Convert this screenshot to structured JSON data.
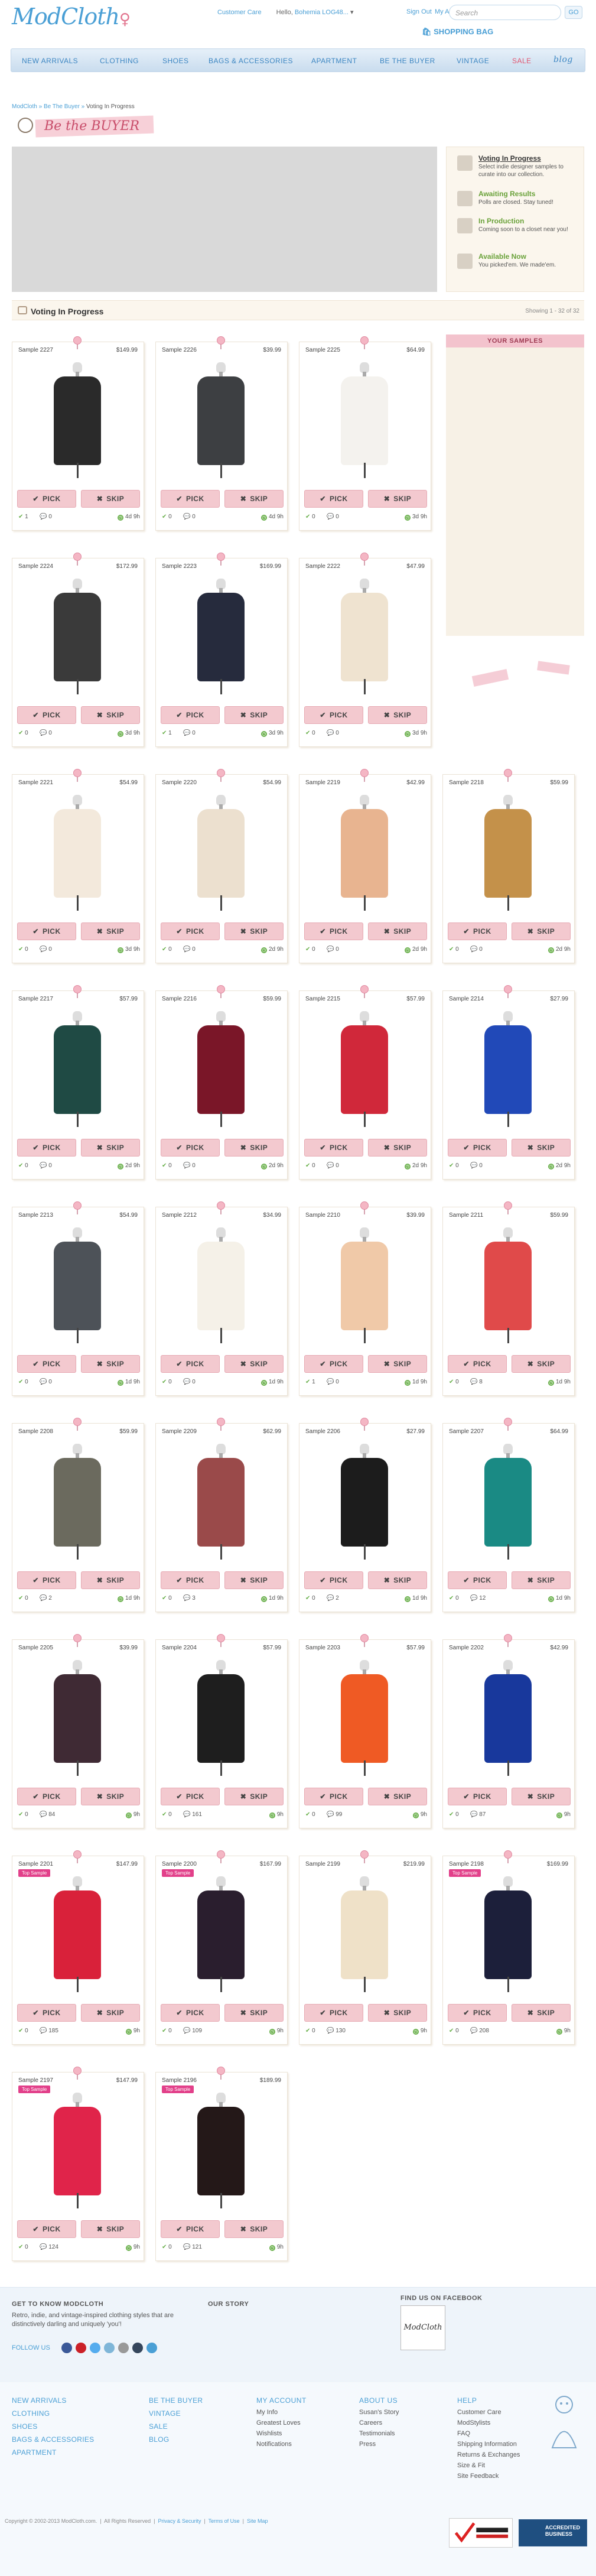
{
  "header": {
    "logo": "ModCloth",
    "customer_care": "Customer Care",
    "hello_prefix": "Hello,",
    "hello_name": "Bohemia LOG48...",
    "sign_out": "Sign Out",
    "my_account": "My Account",
    "search_placeholder": "Search",
    "search_go": "GO",
    "bag": "SHOPPING BAG"
  },
  "nav": [
    "NEW ARRIVALS",
    "CLOTHING",
    "SHOES",
    "BAGS & ACCESSORIES",
    "APARTMENT",
    "BE THE BUYER",
    "VINTAGE",
    "SALE",
    "blog"
  ],
  "breadcrumb": [
    "ModCloth",
    "Be The Buyer",
    "Voting In Progress"
  ],
  "banner_title": "Be the BUYER",
  "steps": [
    {
      "title": "Voting In Progress",
      "desc": "Select indie designer samples to curate into our collection."
    },
    {
      "title": "Awaiting Results",
      "desc": "Polls are closed. Stay tuned!"
    },
    {
      "title": "In Production",
      "desc": "Coming soon to a closet near you!"
    },
    {
      "title": "Available Now",
      "desc": "You picked'em. We made'em."
    }
  ],
  "section": {
    "title": "Voting In Progress",
    "count": "Showing 1 - 32 of 32"
  },
  "your_samples": "YOUR SAMPLES",
  "pick_label": "PICK",
  "skip_label": "SKIP",
  "products": [
    {
      "name": "Sample 2227",
      "price": "$149.99",
      "picks": "1",
      "comments": "0",
      "time": "4d 9h",
      "color": "#2a2a2a"
    },
    {
      "name": "Sample 2226",
      "price": "$39.99",
      "picks": "0",
      "comments": "0",
      "time": "4d 9h",
      "color": "#3d3f42"
    },
    {
      "name": "Sample 2225",
      "price": "$64.99",
      "picks": "0",
      "comments": "0",
      "time": "3d 9h",
      "color": "#f4f2ee"
    },
    {
      "name": "Sample 2224",
      "price": "$172.99",
      "picks": "0",
      "comments": "0",
      "time": "3d 9h",
      "color": "#3a3a3a"
    },
    {
      "name": "Sample 2223",
      "price": "$169.99",
      "picks": "1",
      "comments": "0",
      "time": "3d 9h",
      "color": "#262b3d"
    },
    {
      "name": "Sample 2222",
      "price": "$47.99",
      "picks": "0",
      "comments": "0",
      "time": "3d 9h",
      "color": "#efe3d0"
    },
    {
      "name": "Sample 2221",
      "price": "$54.99",
      "picks": "0",
      "comments": "0",
      "time": "3d 9h",
      "color": "#f3e9dc"
    },
    {
      "name": "Sample 2220",
      "price": "$54.99",
      "picks": "0",
      "comments": "0",
      "time": "2d 9h",
      "color": "#ece0cf"
    },
    {
      "name": "Sample 2219",
      "price": "$42.99",
      "picks": "0",
      "comments": "0",
      "time": "2d 9h",
      "color": "#e8b490"
    },
    {
      "name": "Sample 2218",
      "price": "$59.99",
      "picks": "0",
      "comments": "0",
      "time": "2d 9h",
      "color": "#c4914a"
    },
    {
      "name": "Sample 2217",
      "price": "$57.99",
      "picks": "0",
      "comments": "0",
      "time": "2d 9h",
      "color": "#1f4a44"
    },
    {
      "name": "Sample 2216",
      "price": "$59.99",
      "picks": "0",
      "comments": "0",
      "time": "2d 9h",
      "color": "#7a1628"
    },
    {
      "name": "Sample 2215",
      "price": "$57.99",
      "picks": "0",
      "comments": "0",
      "time": "2d 9h",
      "color": "#d0283a"
    },
    {
      "name": "Sample 2214",
      "price": "$27.99",
      "picks": "0",
      "comments": "0",
      "time": "2d 9h",
      "color": "#2149b8"
    },
    {
      "name": "Sample 2213",
      "price": "$54.99",
      "picks": "0",
      "comments": "0",
      "time": "1d 9h",
      "color": "#4d5258"
    },
    {
      "name": "Sample 2212",
      "price": "$34.99",
      "picks": "0",
      "comments": "0",
      "time": "1d 9h",
      "color": "#f5f1e8"
    },
    {
      "name": "Sample 2210",
      "price": "$39.99",
      "picks": "1",
      "comments": "0",
      "time": "1d 9h",
      "color": "#f0c9a8"
    },
    {
      "name": "Sample 2211",
      "price": "$59.99",
      "picks": "0",
      "comments": "8",
      "time": "1d 9h",
      "color": "#e04a4a"
    },
    {
      "name": "Sample 2208",
      "price": "$59.99",
      "picks": "0",
      "comments": "2",
      "time": "1d 9h",
      "color": "#6b6a5e"
    },
    {
      "name": "Sample 2209",
      "price": "$62.99",
      "picks": "0",
      "comments": "3",
      "time": "1d 9h",
      "color": "#9a4a4a"
    },
    {
      "name": "Sample 2206",
      "price": "$27.99",
      "picks": "0",
      "comments": "2",
      "time": "1d 9h",
      "color": "#1c1c1c"
    },
    {
      "name": "Sample 2207",
      "price": "$64.99",
      "picks": "0",
      "comments": "12",
      "time": "1d 9h",
      "color": "#1a8a84"
    },
    {
      "name": "Sample 2205",
      "price": "$39.99",
      "picks": "0",
      "comments": "84",
      "time": "9h",
      "color": "#3f2a34"
    },
    {
      "name": "Sample 2204",
      "price": "$57.99",
      "picks": "0",
      "comments": "161",
      "time": "9h",
      "color": "#1e1e1e"
    },
    {
      "name": "Sample 2203",
      "price": "$57.99",
      "picks": "0",
      "comments": "99",
      "time": "9h",
      "color": "#ef5a24"
    },
    {
      "name": "Sample 2202",
      "price": "$42.99",
      "picks": "0",
      "comments": "87",
      "time": "9h",
      "color": "#18389c"
    },
    {
      "name": "Sample 2201",
      "price": "$147.99",
      "picks": "0",
      "comments": "185",
      "time": "9h",
      "color": "#d9213a",
      "badge": "Top Sample"
    },
    {
      "name": "Sample 2200",
      "price": "$167.99",
      "picks": "0",
      "comments": "109",
      "time": "9h",
      "color": "#2a1e2e",
      "badge": "Top Sample"
    },
    {
      "name": "Sample 2199",
      "price": "$219.99",
      "picks": "0",
      "comments": "130",
      "time": "9h",
      "color": "#efe1c8"
    },
    {
      "name": "Sample 2198",
      "price": "$169.99",
      "picks": "0",
      "comments": "208",
      "time": "9h",
      "color": "#1c1f3a",
      "badge": "Top Sample"
    },
    {
      "name": "Sample 2197",
      "price": "$147.99",
      "picks": "0",
      "comments": "124",
      "time": "9h",
      "color": "#e0244a",
      "badge": "Top Sample"
    },
    {
      "name": "Sample 2196",
      "price": "$189.99",
      "picks": "0",
      "comments": "121",
      "time": "9h",
      "color": "#241818",
      "badge": "Top Sample"
    }
  ],
  "footer": {
    "about_title": "GET TO KNOW MODCLOTH",
    "about_text": "Retro, indie, and vintage-inspired clothing styles that are distinctively darling and uniquely 'you'!",
    "story_title": "OUR STORY",
    "fb_title": "FIND US ON FACEBOOK",
    "fb_logo": "ModCloth",
    "follow_us": "FOLLOW US",
    "col1": [
      "NEW ARRIVALS",
      "CLOTHING",
      "SHOES",
      "BAGS & ACCESSORIES",
      "APARTMENT"
    ],
    "col2": [
      "BE THE BUYER",
      "VINTAGE",
      "SALE",
      "BLOG"
    ],
    "col3_title": "MY ACCOUNT",
    "col3": [
      "My Info",
      "Greatest Loves",
      "Wishlists",
      "Notifications"
    ],
    "col4_title": "ABOUT US",
    "col4": [
      "Susan's Story",
      "Careers",
      "Testimonials",
      "Press"
    ],
    "col5_title": "HELP",
    "col5": [
      "Customer Care",
      "ModStylists",
      "FAQ",
      "Shipping Information",
      "Returns & Exchanges",
      "Size & Fit",
      "Site Feedback"
    ],
    "copyright": "Copyright © 2002-2013 ModCloth.com.",
    "rights": "All Rights Reserved",
    "privacy": "Privacy & Security",
    "terms": "Terms of Use",
    "sitemap": "Site Map",
    "bbb": "ACCREDITED BUSINESS"
  }
}
